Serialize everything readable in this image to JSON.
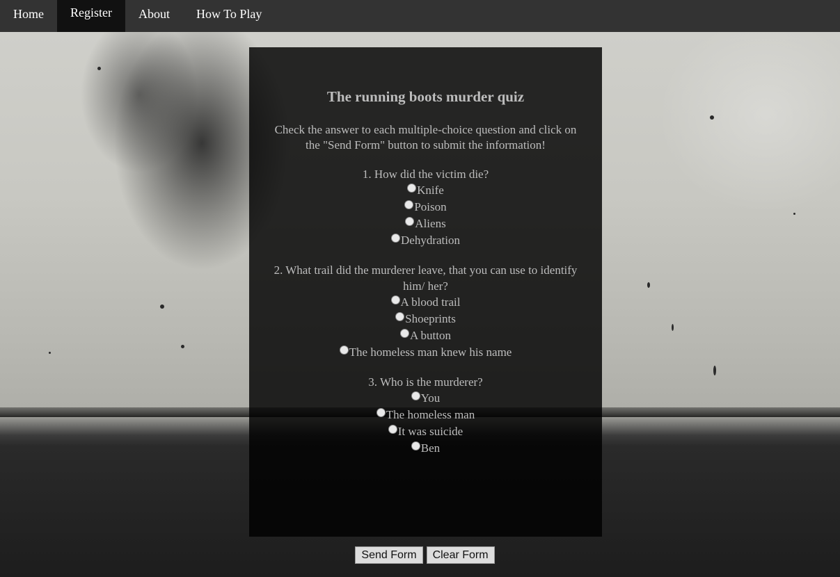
{
  "nav": {
    "items": [
      {
        "label": "Home",
        "active": false
      },
      {
        "label": "Register",
        "active": true
      },
      {
        "label": "About",
        "active": false
      },
      {
        "label": "How To Play",
        "active": false
      }
    ]
  },
  "quiz": {
    "title": "The running boots murder quiz",
    "intro": "Check the answer to each multiple-choice question and click on the \"Send Form\" button to submit the information!",
    "questions": [
      {
        "text": "1. How did the victim die?",
        "options": [
          "Knife",
          "Poison",
          "Aliens",
          "Dehydration"
        ]
      },
      {
        "text": "2. What trail did the murderer leave, that you can use to identify him/ her?",
        "options": [
          "A blood trail",
          "Shoeprints",
          "A button",
          "The homeless man knew his name"
        ]
      },
      {
        "text": "3. Who is the murderer?",
        "options": [
          "You",
          "The homeless man",
          "It was suicide",
          "Ben"
        ]
      }
    ]
  },
  "form": {
    "send_label": "Send Form",
    "clear_label": "Clear Form"
  },
  "colors": {
    "navbar": "#333333",
    "nav_active": "#111111",
    "panel_text": "#bdbdbd"
  }
}
